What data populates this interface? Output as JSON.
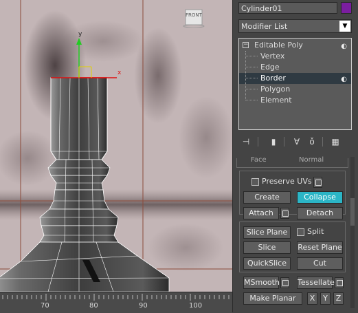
{
  "viewport": {
    "viewcube_label": "FRONT",
    "gizmo_x": "x",
    "gizmo_y": "y",
    "ruler_labels": [
      "70",
      "80",
      "90",
      "100"
    ]
  },
  "panel": {
    "object_name": "Cylinder01",
    "object_color": "#7b1ea0",
    "modifier_list_label": "Modifier List",
    "stack": {
      "root": "Editable Poly",
      "subitems": [
        "Vertex",
        "Edge",
        "Border",
        "Polygon",
        "Element"
      ],
      "selected": "Border"
    },
    "toolbar_icons": [
      "pin-stack-icon",
      "show-end-result-icon",
      "make-unique-icon",
      "remove-modifier-icon",
      "configure-modifier-sets-icon"
    ],
    "rollout": {
      "partial_left": "Face",
      "partial_right": "Normal",
      "preserve_uvs_label": "Preserve UVs",
      "create": "Create",
      "collapse": "Collapse",
      "attach": "Attach",
      "detach": "Detach",
      "slice_plane": "Slice Plane",
      "split": "Split",
      "slice": "Slice",
      "reset_plane": "Reset Plane",
      "quickslice": "QuickSlice",
      "cut": "Cut",
      "msmooth": "MSmooth",
      "tessellate": "Tessellate",
      "make_planar": "Make Planar",
      "x": "X",
      "y": "Y",
      "z": "Z"
    },
    "accent_color": "#2bb5c6"
  }
}
